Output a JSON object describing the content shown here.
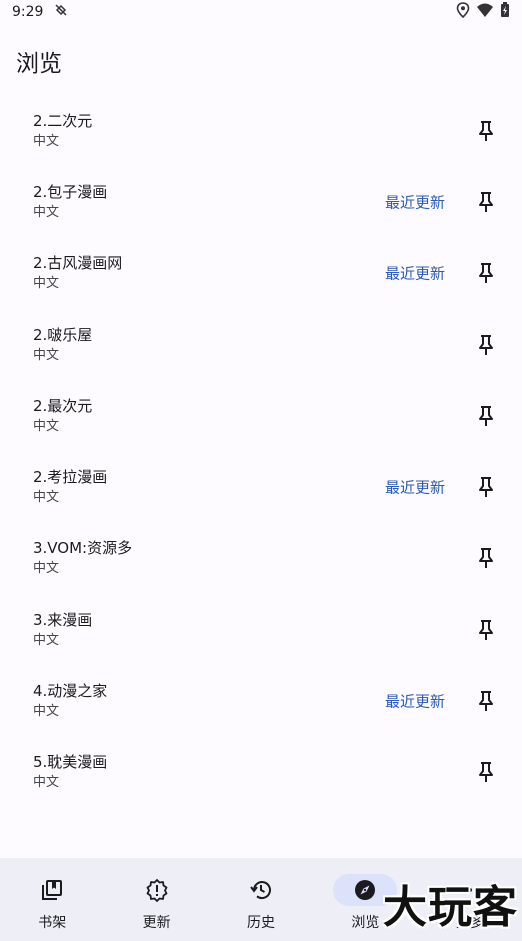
{
  "status_bar": {
    "time": "9:29"
  },
  "page": {
    "title": "浏览"
  },
  "sources": [
    {
      "name": "2.二次元",
      "lang": "中文",
      "latest": ""
    },
    {
      "name": "2.包子漫画",
      "lang": "中文",
      "latest": "最近更新"
    },
    {
      "name": "2.古风漫画网",
      "lang": "中文",
      "latest": "最近更新"
    },
    {
      "name": "2.啵乐屋",
      "lang": "中文",
      "latest": ""
    },
    {
      "name": "2.最次元",
      "lang": "中文",
      "latest": ""
    },
    {
      "name": "2.考拉漫画",
      "lang": "中文",
      "latest": "最近更新"
    },
    {
      "name": "3.VOM:资源多",
      "lang": "中文",
      "latest": ""
    },
    {
      "name": "3.来漫画",
      "lang": "中文",
      "latest": ""
    },
    {
      "name": "4.动漫之家",
      "lang": "中文",
      "latest": "最近更新"
    },
    {
      "name": "5.耽美漫画",
      "lang": "中文",
      "latest": ""
    }
  ],
  "bottom_nav": [
    {
      "label": "书架",
      "icon": "library-icon",
      "active": false
    },
    {
      "label": "更新",
      "icon": "updates-alert-icon",
      "active": false
    },
    {
      "label": "历史",
      "icon": "history-icon",
      "active": false
    },
    {
      "label": "浏览",
      "icon": "explore-compass-icon",
      "active": true
    },
    {
      "label": "更多",
      "icon": "more-horizontal-icon",
      "active": false
    }
  ],
  "watermark": "大玩客",
  "colors": {
    "accent": "#2A5BB8",
    "nav_bg": "#EEEEF6",
    "active_pill": "#DCE2F9",
    "background": "#FDFBFF"
  }
}
